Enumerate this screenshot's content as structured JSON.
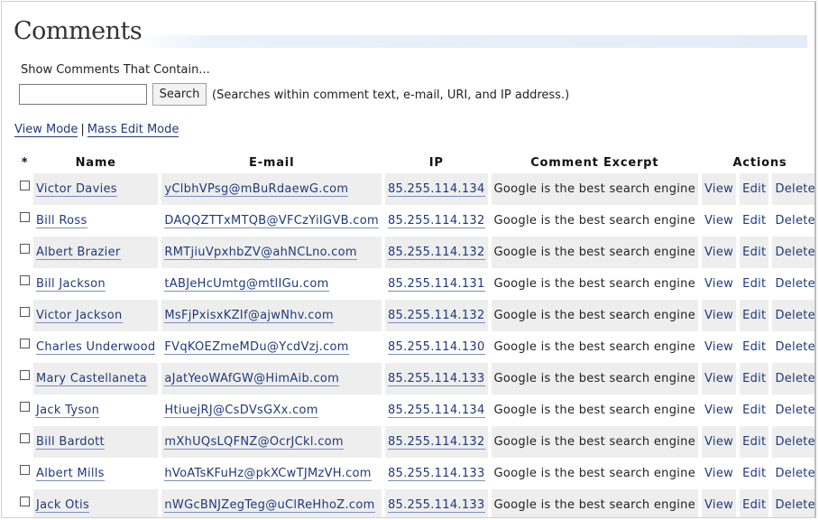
{
  "page": {
    "title": "Comments"
  },
  "search": {
    "label": "Show Comments That Contain...",
    "value": "",
    "placeholder": "",
    "button_label": "Search",
    "hint": "(Searches within comment text, e-mail, URI, and IP address.)"
  },
  "modes": {
    "view_mode": "View Mode",
    "separator": "|",
    "mass_edit_mode": "Mass Edit Mode"
  },
  "table": {
    "headers": {
      "select": "*",
      "name": "Name",
      "email": "E-mail",
      "ip": "IP",
      "excerpt": "Comment Excerpt",
      "actions": "Actions"
    },
    "action_labels": {
      "view": "View",
      "edit": "Edit",
      "delete": "Delete"
    },
    "rows": [
      {
        "name": "Victor Davies",
        "email": "yClbhVPsg@mBuRdaewG.com",
        "ip": "85.255.114.134",
        "excerpt": "Google is the best search engine",
        "checked": false
      },
      {
        "name": "Bill Ross",
        "email": "DAQQZTTxMTQB@VFCzYiIGVB.com",
        "ip": "85.255.114.132",
        "excerpt": "Google is the best search engine",
        "checked": false
      },
      {
        "name": "Albert Brazier",
        "email": "RMTjiuVpxhbZV@ahNCLno.com",
        "ip": "85.255.114.132",
        "excerpt": "Google is the best search engine",
        "checked": false
      },
      {
        "name": "Bill Jackson",
        "email": "tABJeHcUmtg@mtlIGu.com",
        "ip": "85.255.114.131",
        "excerpt": "Google is the best search engine",
        "checked": false
      },
      {
        "name": "Victor Jackson",
        "email": "MsFjPxisxKZIf@ajwNhv.com",
        "ip": "85.255.114.132",
        "excerpt": "Google is the best search engine",
        "checked": false
      },
      {
        "name": "Charles Underwood",
        "email": "FVqKOEZmeMDu@YcdVzj.com",
        "ip": "85.255.114.130",
        "excerpt": "Google is the best search engine",
        "checked": false
      },
      {
        "name": "Mary Castellaneta",
        "email": "aJatYeoWAfGW@HimAib.com",
        "ip": "85.255.114.133",
        "excerpt": "Google is the best search engine",
        "checked": false
      },
      {
        "name": "Jack Tyson",
        "email": "HtiuejRJ@CsDVsGXx.com",
        "ip": "85.255.114.134",
        "excerpt": "Google is the best search engine",
        "checked": false
      },
      {
        "name": "Bill Bardott",
        "email": "mXhUQsLQFNZ@OcrJCkl.com",
        "ip": "85.255.114.132",
        "excerpt": "Google is the best search engine",
        "checked": false
      },
      {
        "name": "Albert Mills",
        "email": "hVoATsKFuHz@pkXCwTJMzVH.com",
        "ip": "85.255.114.133",
        "excerpt": "Google is the best search engine",
        "checked": false
      },
      {
        "name": "Jack Otis",
        "email": "nWGcBNJZegTeg@uClReHhoZ.com",
        "ip": "85.255.114.133",
        "excerpt": "Google is the best search engine",
        "checked": false
      }
    ]
  },
  "colors": {
    "link": "#20397a",
    "row_shade": "#eeeeee",
    "title_band": "#e3ecf7"
  }
}
